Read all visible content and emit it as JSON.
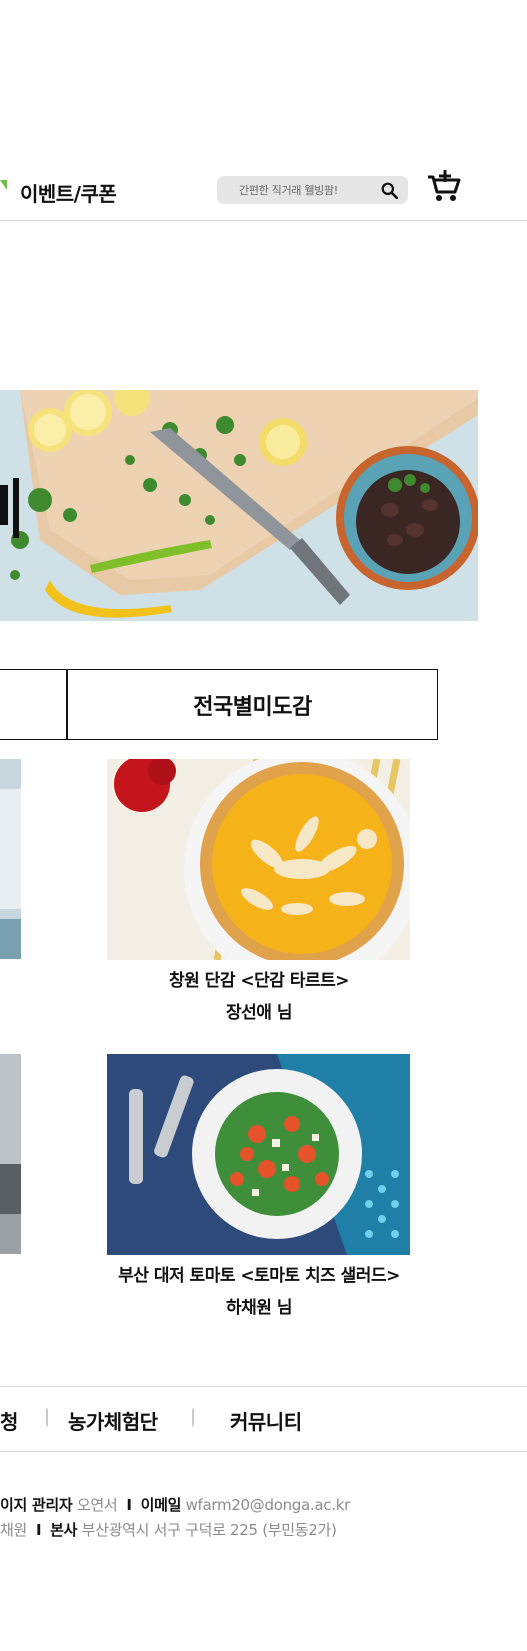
{
  "header": {
    "event_label": "이벤트/쿠폰",
    "search_placeholder": "간편한 직거래 웰빙팜!",
    "colors": {
      "accent": "#6cc04a",
      "search_bg": "#e6e6e6"
    }
  },
  "tabs": [
    {
      "label": ""
    },
    {
      "label": "전국별미도감"
    }
  ],
  "cards": [
    {
      "title": "창원 단감 <단감 타르트>",
      "author": "장선애 님"
    },
    {
      "title": "부산 대저 토마토 <토마토 치즈 샐러드>",
      "author": "하채원 님"
    }
  ],
  "footer_nav": {
    "item_partial": "청",
    "item_farm": "농가체험단",
    "item_community": "커뮤니티",
    "separator": "|"
  },
  "footer_info": {
    "line1": {
      "k1": "이지 관리자",
      "v1": "오연서",
      "sep": "I",
      "k2": "이메일",
      "v2": "wfarm20@donga.ac.kr"
    },
    "line2": {
      "v0": "채원",
      "sep": "I",
      "k1": "본사",
      "v1": "부산광역시 서구 구덕로 225 (부민동2가)"
    }
  }
}
